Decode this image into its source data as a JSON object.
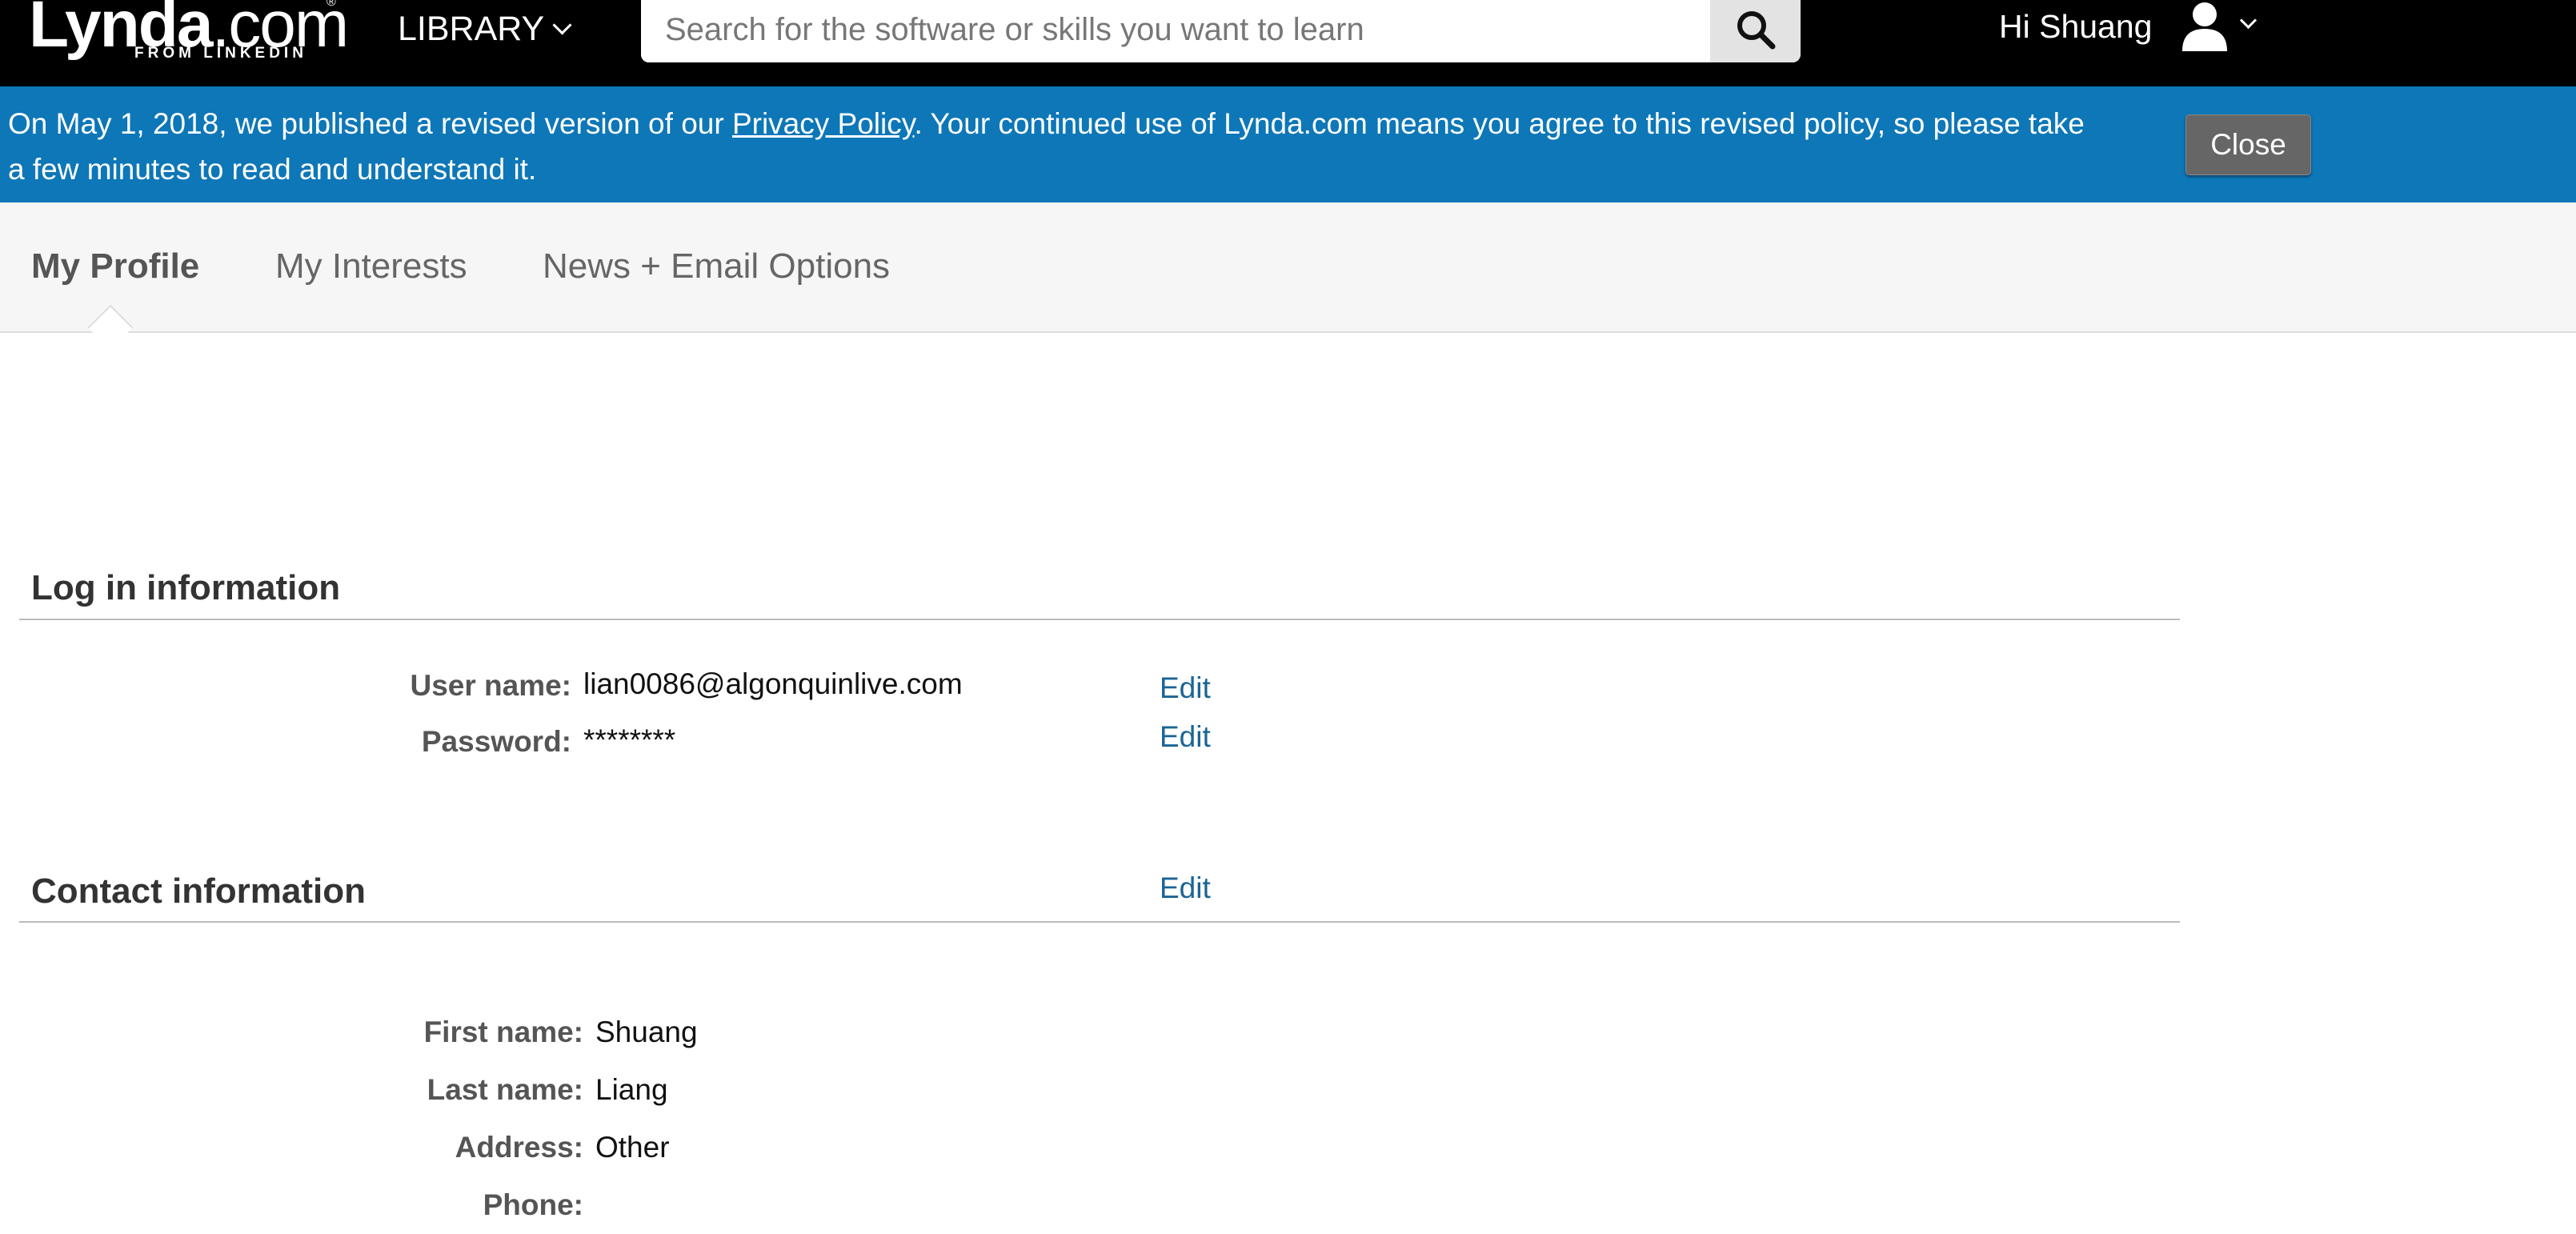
{
  "header": {
    "logo_text_bold": "Lynda",
    "logo_text_rest": ".com",
    "logo_registered": "®",
    "logo_sub": "FROM LINKEDIN",
    "library_label": "LIBRARY",
    "search": {
      "placeholder": "Search for the software or skills you want to learn",
      "value": ""
    },
    "greeting": "Hi Shuang",
    "icons": {
      "search": "search-icon",
      "account": "user-icon",
      "dropdown": "chevron-down-icon"
    }
  },
  "banner": {
    "text_before": "On May 1, 2018, we published a revised version of our ",
    "link_text": "Privacy Policy",
    "text_after": ". Your continued use of Lynda.com means you agree to this revised policy, so please take a few minutes to read and understand it.",
    "close_label": "Close"
  },
  "tabs": [
    {
      "label": "My Profile",
      "active": true
    },
    {
      "label": "My Interests",
      "active": false
    },
    {
      "label": "News + Email Options",
      "active": false
    }
  ],
  "login": {
    "title": "Log in information",
    "username_label": "User name:",
    "username_value": "lian0086@algonquinlive.com",
    "password_label": "Password:",
    "password_value": "********",
    "edit_label": "Edit"
  },
  "contact": {
    "title": "Contact information",
    "edit_label": "Edit",
    "fields": [
      {
        "label": "First name:",
        "value": "Shuang"
      },
      {
        "label": "Last name:",
        "value": "Liang"
      },
      {
        "label": "Address:",
        "value": "Other"
      },
      {
        "label": "Phone:",
        "value": ""
      }
    ]
  },
  "colors": {
    "banner": "#0d77b8",
    "link": "#1a6496",
    "topnav": "#000000"
  }
}
